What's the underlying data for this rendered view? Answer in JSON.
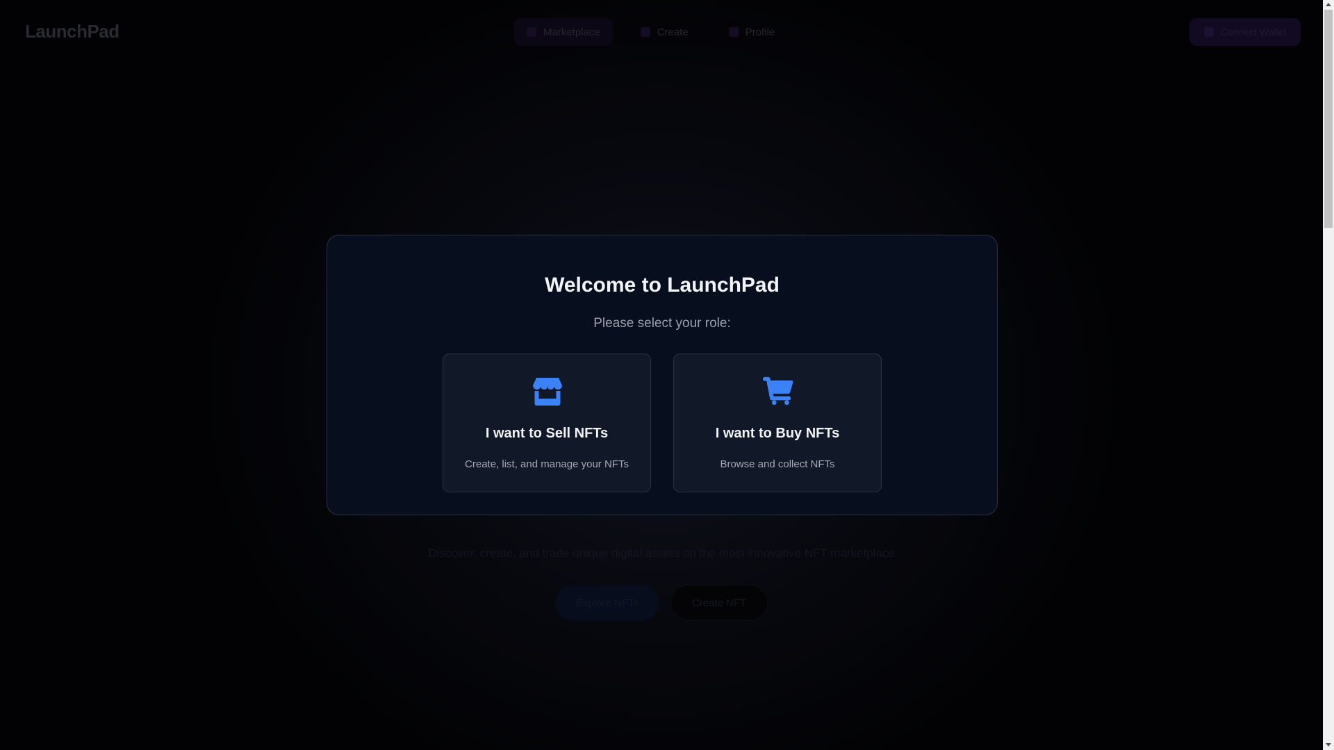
{
  "navbar": {
    "logo": "LaunchPad",
    "links": [
      {
        "label": "Marketplace",
        "icon": "store-icon"
      },
      {
        "label": "Create",
        "icon": "plus-icon"
      },
      {
        "label": "Profile",
        "icon": "user-icon"
      }
    ],
    "connect_label": "Connect Wallet"
  },
  "hero": {
    "description": "Discover, create, and trade unique digital assets on the most innovative NFT marketplace",
    "primary_button": "Explore NFTs",
    "secondary_button": "Create NFT"
  },
  "modal": {
    "title": "Welcome to LaunchPad",
    "subtitle": "Please select your role:",
    "roles": [
      {
        "title": "I want to Sell NFTs",
        "description": "Create, list, and manage your NFTs",
        "icon": "store-icon"
      },
      {
        "title": "I want to Buy NFTs",
        "description": "Browse and collect NFTs",
        "icon": "shopping-cart-icon"
      }
    ]
  },
  "colors": {
    "accent_blue": "#3b82f6",
    "modal_bg": "#070f1e",
    "card_bg": "#111827"
  }
}
